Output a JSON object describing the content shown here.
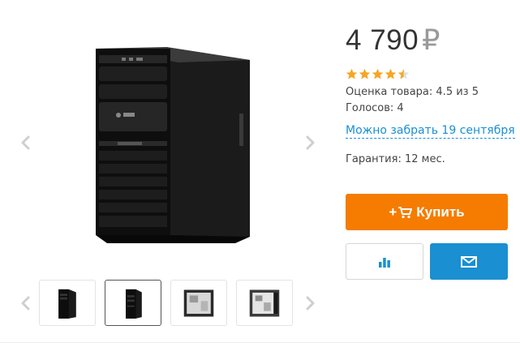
{
  "product": {
    "price_value": "4 790",
    "currency_symbol": "₽",
    "rating_stars": 4.5,
    "rating_label": "Оценка товара: 4.5 из 5",
    "votes_label": "Голосов: 4",
    "pickup_link": "Можно забрать 19 сентября",
    "warranty_label": "Гарантия: 12 мес."
  },
  "actions": {
    "buy_label": "Купить",
    "buy_icon": "cart-icon",
    "compare_icon": "bar-chart-icon",
    "mail_icon": "envelope-icon"
  },
  "gallery": {
    "thumbnails": [
      "case-front-thumb",
      "case-angle-thumb",
      "case-open-side-thumb",
      "case-interior-thumb"
    ],
    "active_thumbnail": 1
  },
  "colors": {
    "accent_orange": "#f57c00",
    "accent_blue": "#1a8fd2",
    "star_gold": "#f5a623"
  }
}
